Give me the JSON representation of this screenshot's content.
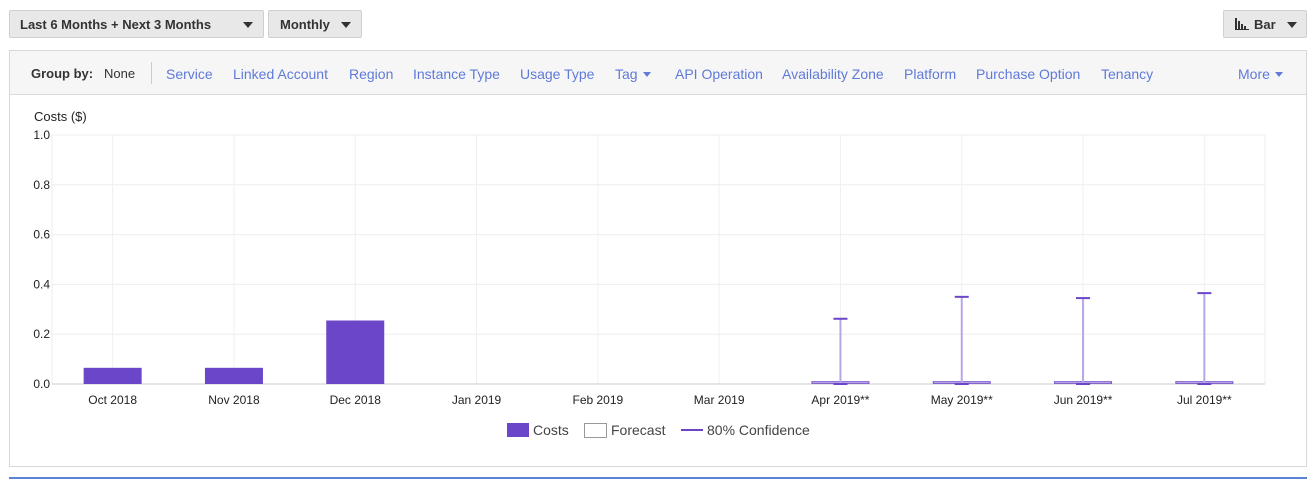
{
  "toolbar": {
    "range_label": "Last 6 Months + Next 3 Months",
    "granularity_label": "Monthly",
    "chart_type_label": "Bar"
  },
  "groupby": {
    "label": "Group by:",
    "current": "None",
    "items": [
      "Service",
      "Linked Account",
      "Region",
      "Instance Type",
      "Usage Type",
      "Tag",
      "API Operation",
      "Availability Zone",
      "Platform",
      "Purchase Option",
      "Tenancy",
      "More"
    ]
  },
  "colors": {
    "costs": "#6b46c9",
    "link": "#5f7ad8",
    "confidence": "#6b46c9"
  },
  "chart_data": {
    "type": "bar",
    "ylabel": "Costs ($)",
    "ylim": [
      0,
      1.0
    ],
    "yticks": [
      "1.0",
      "0.8",
      "0.6",
      "0.4",
      "0.2",
      "0.0"
    ],
    "grid": true,
    "legend_position": "bottom",
    "categories": [
      "Oct 2018",
      "Nov 2018",
      "Dec 2018",
      "Jan 2019",
      "Feb 2019",
      "Mar 2019",
      "Apr 2019**",
      "May 2019**",
      "Jun 2019**",
      "Jul 2019**"
    ],
    "series": [
      {
        "name": "Costs",
        "values": [
          0.065,
          0.065,
          0.255,
          0,
          0,
          0,
          null,
          null,
          null,
          null
        ]
      },
      {
        "name": "Forecast",
        "values": [
          null,
          null,
          null,
          null,
          null,
          null,
          0.005,
          0.005,
          0.005,
          0.005
        ]
      },
      {
        "name": "80% Confidence",
        "values": [
          null,
          null,
          null,
          null,
          null,
          null,
          0.262,
          0.35,
          0.345,
          0.365
        ]
      }
    ]
  }
}
